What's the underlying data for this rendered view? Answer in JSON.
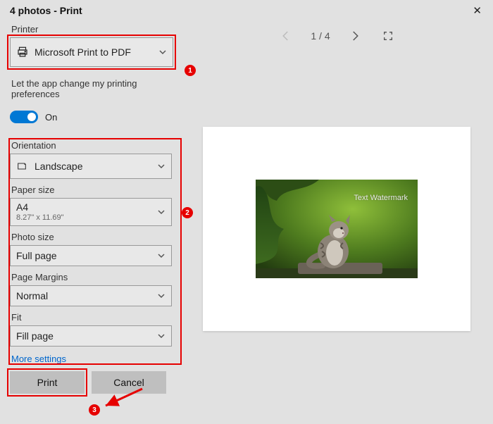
{
  "window": {
    "title": "4 photos - Print"
  },
  "left": {
    "printer_label": "Printer",
    "printer_value": "Microsoft Print to PDF",
    "pref_text": "Let the app change my printing preferences",
    "pref_state": "On",
    "orientation_label": "Orientation",
    "orientation_value": "Landscape",
    "paper_label": "Paper size",
    "paper_value": "A4",
    "paper_sub": "8.27\" x 11.69\"",
    "photo_label": "Photo size",
    "photo_value": "Full page",
    "margins_label": "Page Margins",
    "margins_value": "Normal",
    "fit_label": "Fit",
    "fit_value": "Fill page",
    "more_link": "More settings",
    "print_btn": "Print",
    "cancel_btn": "Cancel"
  },
  "annotations": {
    "badge1": "1",
    "badge2": "2",
    "badge3": "3"
  },
  "pager": {
    "position": "1 / 4"
  },
  "preview": {
    "watermark": "Text Watermark"
  }
}
